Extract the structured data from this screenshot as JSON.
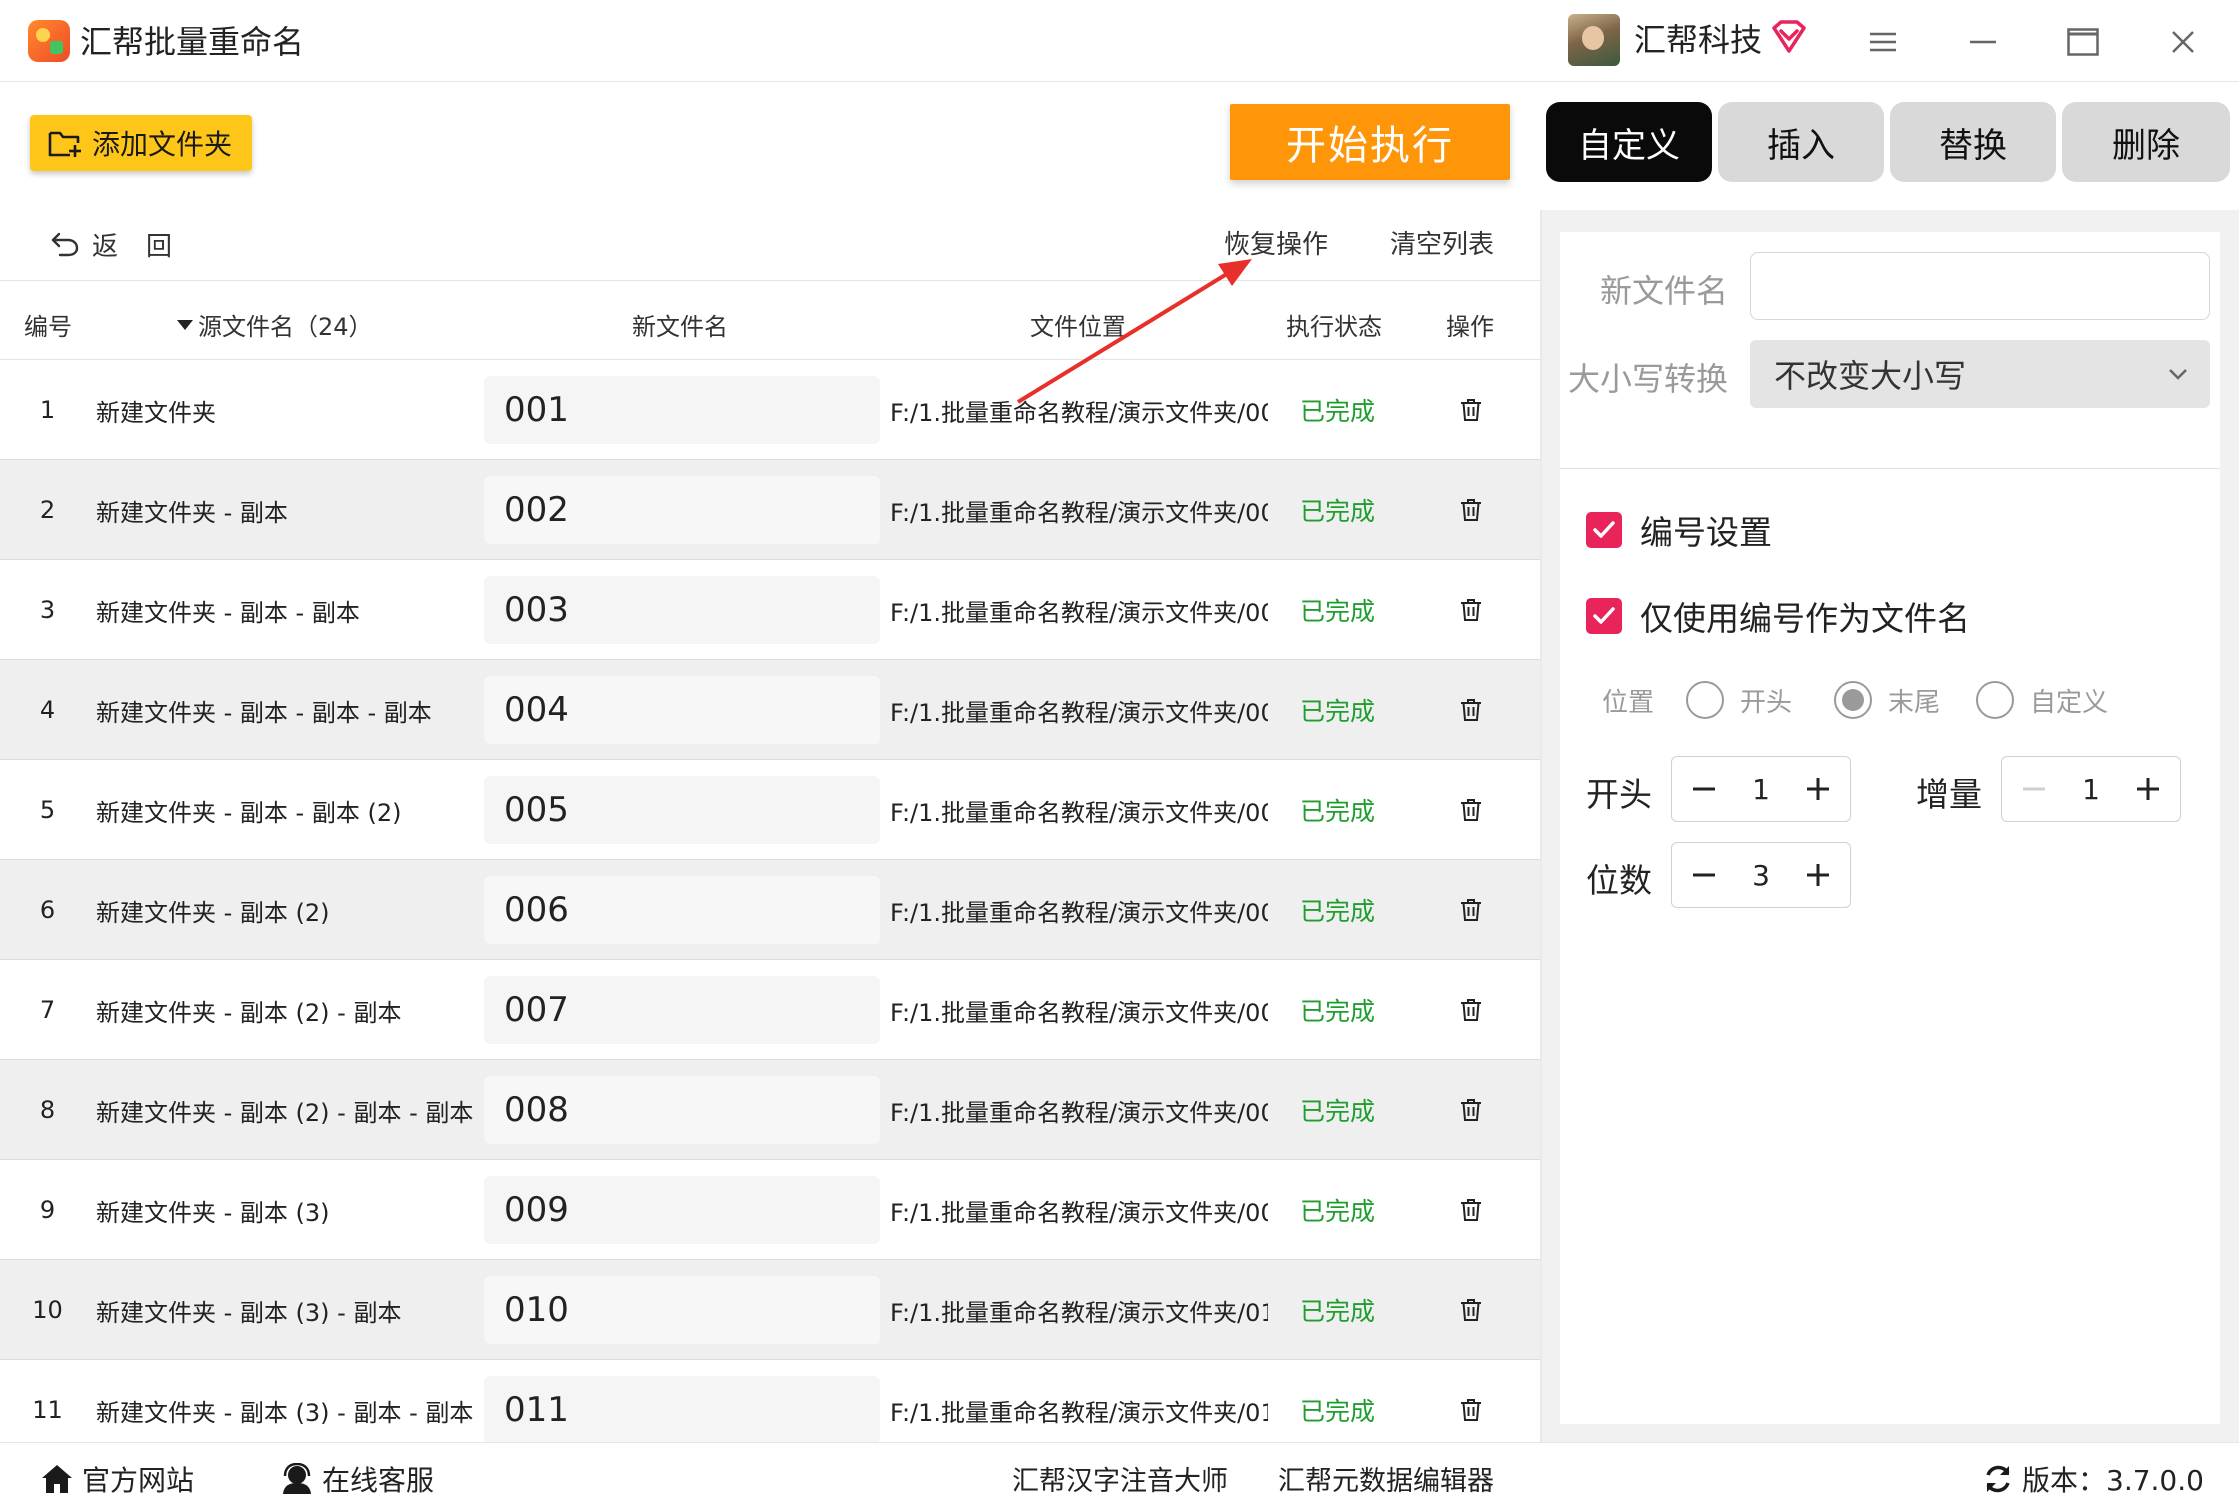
{
  "app": {
    "title": "汇帮批量重命名",
    "brand": "汇帮科技"
  },
  "toolbar": {
    "add_folder": "添加文件夹",
    "start": "开始执行"
  },
  "tabs": [
    {
      "label": "自定义",
      "active": true
    },
    {
      "label": "插入",
      "active": false
    },
    {
      "label": "替换",
      "active": false
    },
    {
      "label": "删除",
      "active": false
    }
  ],
  "subbar": {
    "back": "返回",
    "restore": "恢复操作",
    "clear": "清空列表"
  },
  "table": {
    "headers": {
      "num": "编号",
      "src": "源文件名（24）",
      "new": "新文件名",
      "path": "文件位置",
      "status": "执行状态",
      "op": "操作"
    },
    "rows": [
      {
        "num": "1",
        "src": "新建文件夹",
        "new": "001",
        "path": "F:/1.批量重命名教程/演示文件夹/00",
        "status": "已完成"
      },
      {
        "num": "2",
        "src": "新建文件夹 - 副本",
        "new": "002",
        "path": "F:/1.批量重命名教程/演示文件夹/00",
        "status": "已完成"
      },
      {
        "num": "3",
        "src": "新建文件夹 - 副本 - 副本",
        "new": "003",
        "path": "F:/1.批量重命名教程/演示文件夹/00",
        "status": "已完成"
      },
      {
        "num": "4",
        "src": "新建文件夹 - 副本 - 副本 - 副本",
        "new": "004",
        "path": "F:/1.批量重命名教程/演示文件夹/00",
        "status": "已完成"
      },
      {
        "num": "5",
        "src": "新建文件夹 - 副本 - 副本 (2)",
        "new": "005",
        "path": "F:/1.批量重命名教程/演示文件夹/00",
        "status": "已完成"
      },
      {
        "num": "6",
        "src": "新建文件夹 - 副本 (2)",
        "new": "006",
        "path": "F:/1.批量重命名教程/演示文件夹/00",
        "status": "已完成"
      },
      {
        "num": "7",
        "src": "新建文件夹 - 副本 (2) - 副本",
        "new": "007",
        "path": "F:/1.批量重命名教程/演示文件夹/00",
        "status": "已完成"
      },
      {
        "num": "8",
        "src": "新建文件夹 - 副本 (2) - 副本 - 副本",
        "new": "008",
        "path": "F:/1.批量重命名教程/演示文件夹/00",
        "status": "已完成"
      },
      {
        "num": "9",
        "src": "新建文件夹 - 副本 (3)",
        "new": "009",
        "path": "F:/1.批量重命名教程/演示文件夹/00",
        "status": "已完成"
      },
      {
        "num": "10",
        "src": "新建文件夹 - 副本 (3) - 副本",
        "new": "010",
        "path": "F:/1.批量重命名教程/演示文件夹/01",
        "status": "已完成"
      },
      {
        "num": "11",
        "src": "新建文件夹 - 副本 (3) - 副本 - 副本",
        "new": "011",
        "path": "F:/1.批量重命名教程/演示文件夹/01",
        "status": "已完成"
      }
    ]
  },
  "panel": {
    "newname_label": "新文件名",
    "newname_value": "",
    "case_label": "大小写转换",
    "case_value": "不改变大小写",
    "numbering_label": "编号设置",
    "numbering_checked": true,
    "only_number_label": "仅使用编号作为文件名",
    "only_number_checked": true,
    "position_label": "位置",
    "position_options": [
      "开头",
      "末尾",
      "自定义"
    ],
    "position_selected": "末尾",
    "start_label": "开头",
    "start_value": "1",
    "increment_label": "增量",
    "increment_value": "1",
    "digits_label": "位数",
    "digits_value": "3"
  },
  "footer": {
    "website": "官方网站",
    "support": "在线客服",
    "link1": "汇帮汉字注音大师",
    "link2": "汇帮元数据编辑器",
    "version": "版本：3.7.0.0"
  },
  "colors": {
    "accent_orange": "#ff960a",
    "add_yellow": "#ffc61a",
    "status_green": "#1f9d2e",
    "check_pink": "#e8245a",
    "arrow_red": "#e8302a"
  }
}
